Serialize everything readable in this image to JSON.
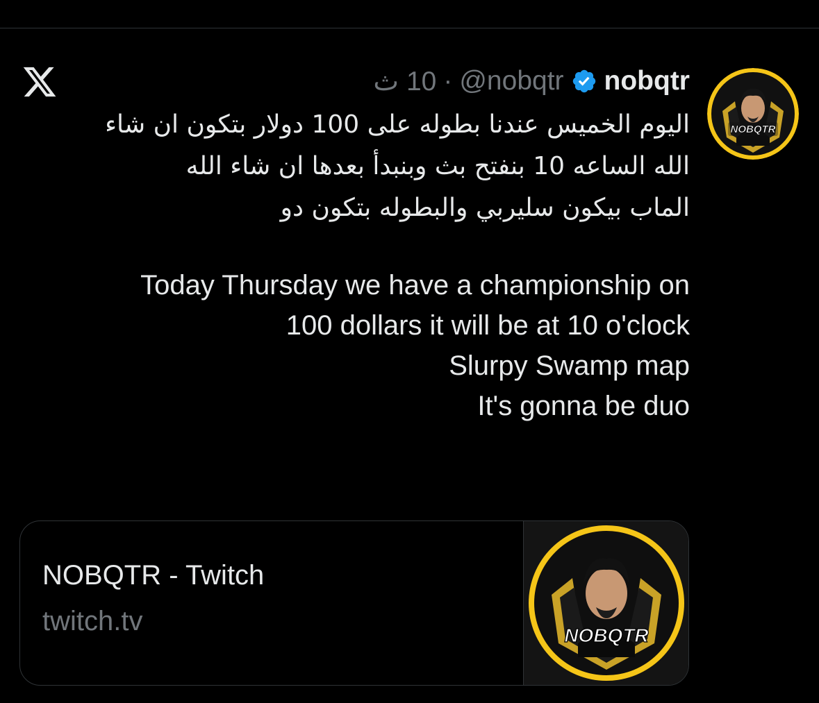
{
  "colors": {
    "background": "#000000",
    "text_primary": "#e7e9ea",
    "text_secondary": "#71767b",
    "verified_blue": "#1d9bf0",
    "avatar_ring": "#f5c518",
    "divider": "#2f3336"
  },
  "icons": {
    "app_logo": "x-logo-icon",
    "verified": "verified-badge-icon"
  },
  "tweet": {
    "author": {
      "display_name": "nobqtr",
      "handle": "@nobqtr",
      "avatar_text": "NOBQTR"
    },
    "separator": "·",
    "time": "10 ث",
    "text_ar": [
      "اليوم الخميس عندنا بطوله على 100 دولار بتكون ان شاء",
      "الله الساعه 10 بنفتح بث وبنبدأ بعدها ان شاء الله",
      "الماب بيكون سليربي والبطوله بتكون دو"
    ],
    "text_en": [
      "Today Thursday we have a championship on",
      "100 dollars it will be at 10 o'clock",
      "Slurpy Swamp map",
      "It's gonna be duo"
    ]
  },
  "link_card": {
    "title": "NOBQTR - Twitch",
    "domain": "twitch.tv",
    "thumb_text": "NOBQTR"
  }
}
